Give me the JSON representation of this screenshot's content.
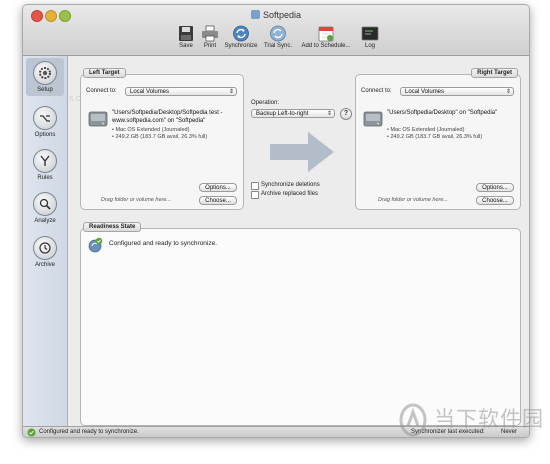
{
  "window": {
    "title": "Softpedia"
  },
  "toolbar": {
    "save": "Save",
    "print": "Print",
    "synchronize": "Synchronize",
    "trial_sync": "Trial Sync.",
    "add_to_schedule": "Add to Schedule...",
    "log": "Log"
  },
  "sidebar": {
    "items": [
      {
        "label": "Setup"
      },
      {
        "label": "Options"
      },
      {
        "label": "Rules"
      },
      {
        "label": "Analyze"
      },
      {
        "label": "Archive"
      }
    ]
  },
  "left_target": {
    "tab": "Left Target",
    "connect_label": "Connect to:",
    "connect_value": "Local Volumes",
    "volume_name": "\"Users/Softpedia/Desktop/Softpedia test - www.softpedia.com\" on \"Softpedia\"",
    "detail_1": "• Mac OS Extended (Journaled)",
    "detail_2": "• 249.2 GB (183.7 GB avail, 26.3% full)",
    "options_button": "Options...",
    "drag_hint": "Drag folder or volume here...",
    "choose_button": "Choose..."
  },
  "right_target": {
    "tab": "Right Target",
    "connect_label": "Connect to:",
    "connect_value": "Local Volumes",
    "volume_name": "\"Users/Softpedia/Desktop\" on \"Softpedia\"",
    "detail_1": "• Mac OS Extended (Journaled)",
    "detail_2": "• 249.2 GB (183.7 GB avail, 26.3% full)",
    "options_button": "Options...",
    "drag_hint": "Drag folder or volume here...",
    "choose_button": "Choose..."
  },
  "operation": {
    "label": "Operation:",
    "value": "Backup Left-to-right",
    "help": "?",
    "sync_deletions": "Synchronize deletions",
    "archive_replaced": "Archive replaced files"
  },
  "readiness": {
    "tab": "Readiness State",
    "message": "Configured and ready to synchronize."
  },
  "statusbar": {
    "message": "Configured and ready to synchronize.",
    "last_executed_label": "Synchronizer last executed:",
    "last_executed_value": "Never"
  },
  "watermark": {
    "left_text": "SOFTPEDIA",
    "logo_text": "当下软件园"
  },
  "colors": {
    "arrow": "#b2bdc9",
    "sidebar": "#d6dde7",
    "status_ok": "#5aa33a"
  },
  "icons": {
    "save": "save-icon",
    "print": "print-icon",
    "synchronize": "synchronize-icon",
    "trial_sync": "trial-sync-icon",
    "add_to_schedule": "calendar-icon",
    "log": "log-icon",
    "setup": "gear-icon",
    "options": "option-key-icon",
    "rules": "branch-icon",
    "analyze": "magnifier-icon",
    "archive": "clock-icon",
    "disk": "hard-disk-icon"
  }
}
